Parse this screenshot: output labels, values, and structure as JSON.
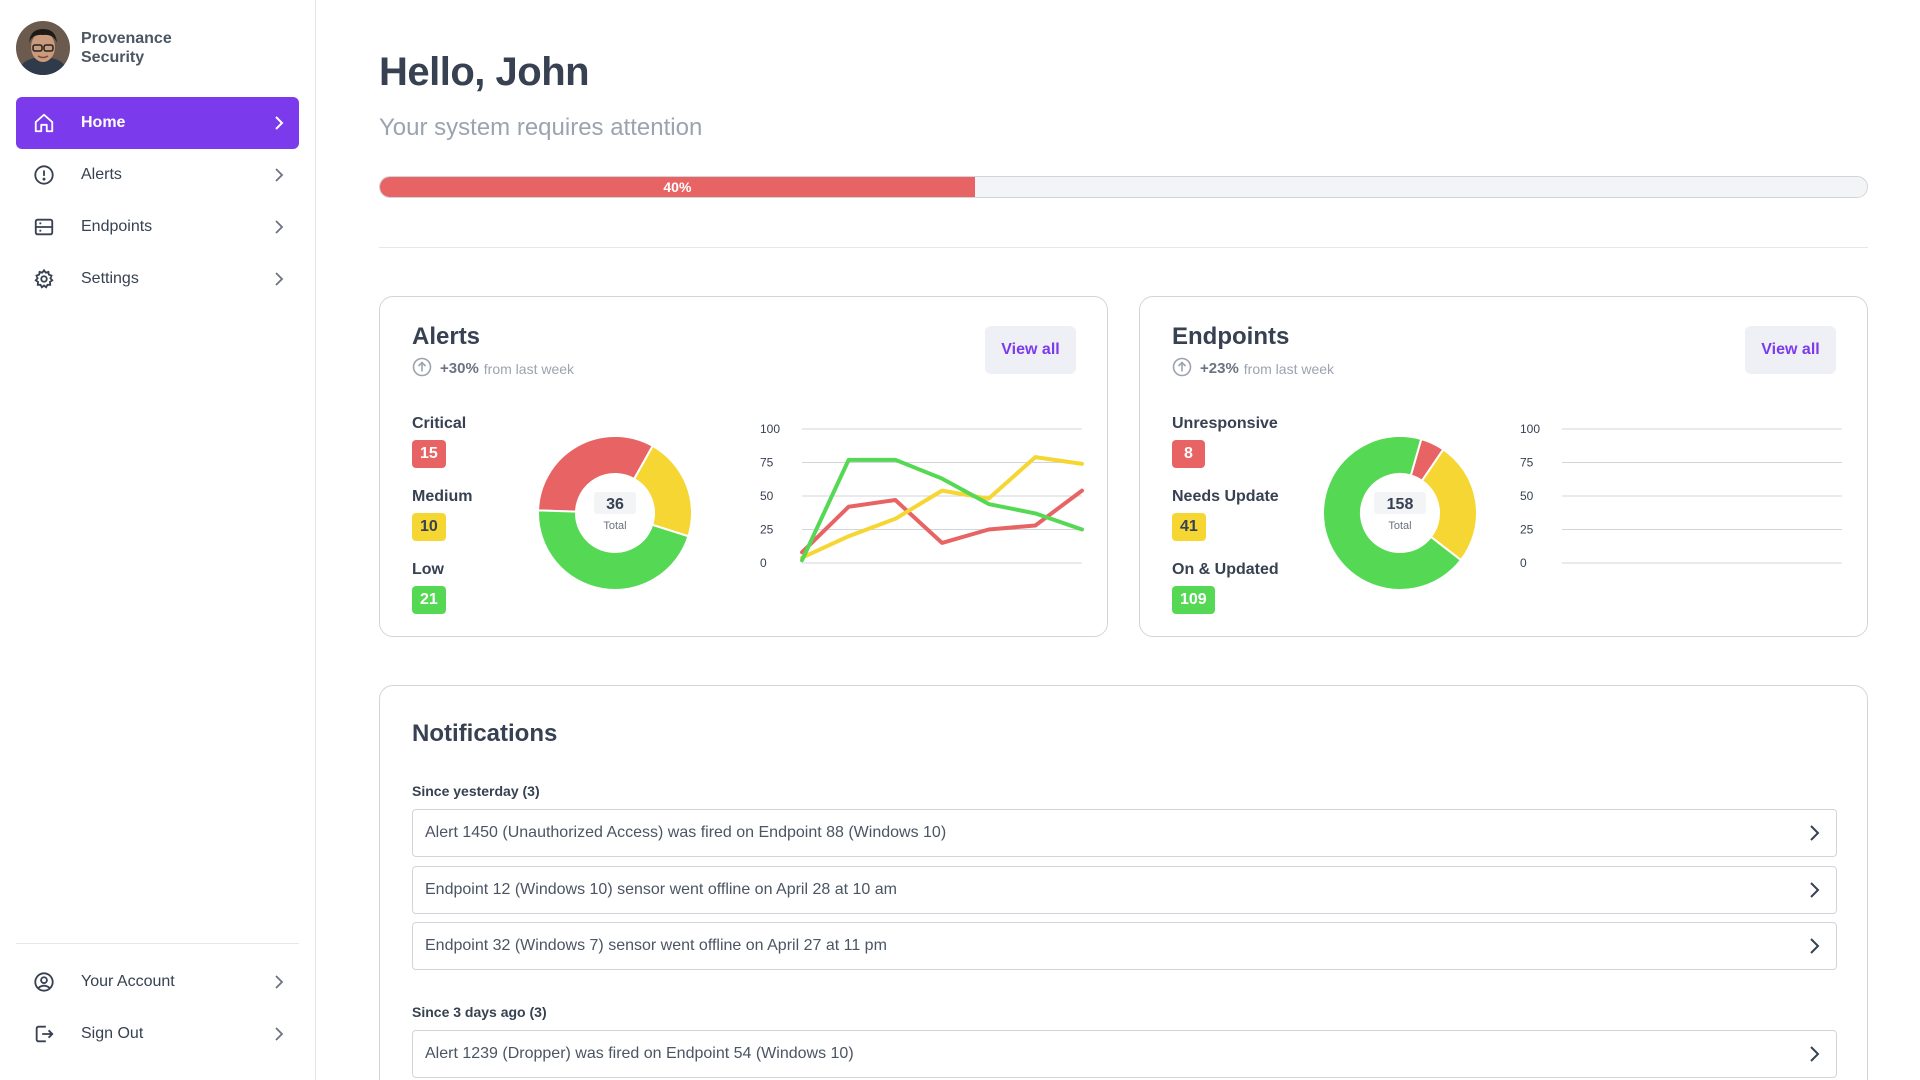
{
  "brand": {
    "name": "Provenance Security"
  },
  "sidebar": {
    "items": [
      {
        "label": "Home",
        "icon": "home-icon",
        "active": true
      },
      {
        "label": "Alerts",
        "icon": "alert-circle-icon",
        "active": false
      },
      {
        "label": "Endpoints",
        "icon": "server-icon",
        "active": false
      },
      {
        "label": "Settings",
        "icon": "gear-icon",
        "active": false
      }
    ],
    "bottom_items": [
      {
        "label": "Your Account",
        "icon": "user-circle-icon"
      },
      {
        "label": "Sign Out",
        "icon": "sign-out-icon"
      }
    ]
  },
  "header": {
    "greeting": "Hello, John",
    "subtitle": "Your system requires attention",
    "progress_label": "40%",
    "progress_value": 40
  },
  "colors": {
    "accent": "#7c3aed",
    "red": "#e86464",
    "yellow": "#f5d633",
    "green": "#55d854"
  },
  "alerts_card": {
    "title": "Alerts",
    "trend_pct": "+30%",
    "trend_text": "from last week",
    "view_all": "View all",
    "legend": [
      {
        "label": "Critical",
        "value": "15",
        "color": "red"
      },
      {
        "label": "Medium",
        "value": "10",
        "color": "yellow"
      },
      {
        "label": "Low",
        "value": "21",
        "color": "green"
      }
    ],
    "donut_total": "36",
    "donut_total_label": "Total"
  },
  "endpoints_card": {
    "title": "Endpoints",
    "trend_pct": "+23%",
    "trend_text": "from last week",
    "view_all": "View all",
    "legend": [
      {
        "label": "Unresponsive",
        "value": "8",
        "color": "red"
      },
      {
        "label": "Needs Update",
        "value": "41",
        "color": "yellow"
      },
      {
        "label": "On & Updated",
        "value": "109",
        "color": "green"
      }
    ],
    "donut_total": "158",
    "donut_total_label": "Total"
  },
  "chart_data": [
    {
      "type": "pie",
      "categories": [
        "Critical",
        "Medium",
        "Low"
      ],
      "values": [
        15,
        10,
        21
      ],
      "colors": [
        "#e86464",
        "#f5d633",
        "#55d854"
      ]
    },
    {
      "type": "line",
      "yticks": [
        0,
        25,
        50,
        75,
        100
      ],
      "ylim": [
        0,
        100
      ],
      "grid": true,
      "series": [
        {
          "color": "#e86464",
          "values": [
            8,
            42,
            47,
            15,
            25,
            28,
            54
          ]
        },
        {
          "color": "#f5d633",
          "values": [
            4,
            20,
            33,
            54,
            48,
            79,
            74
          ]
        },
        {
          "color": "#55d854",
          "values": [
            2,
            77,
            77,
            63,
            44,
            37,
            25
          ]
        }
      ]
    },
    {
      "type": "pie",
      "categories": [
        "Unresponsive",
        "Needs Update",
        "On & Updated"
      ],
      "values": [
        8,
        41,
        109
      ],
      "colors": [
        "#e86464",
        "#f5d633",
        "#55d854"
      ]
    },
    {
      "type": "line",
      "yticks": [
        0,
        25,
        50,
        75,
        100
      ],
      "ylim": [
        0,
        100
      ],
      "grid": true,
      "series": []
    }
  ],
  "notifications": {
    "title": "Notifications",
    "groups": [
      {
        "label": "Since yesterday (3)",
        "items": [
          "Alert 1450 (Unauthorized Access) was fired on Endpoint 88 (Windows 10)",
          "Endpoint 12 (Windows 10) sensor went offline on April 28 at 10 am",
          "Endpoint 32 (Windows 7) sensor went offline on April 27 at 11 pm"
        ]
      },
      {
        "label": "Since 3 days ago (3)",
        "items": [
          "Alert 1239 (Dropper) was fired on Endpoint 54 (Windows 10)"
        ]
      }
    ]
  }
}
